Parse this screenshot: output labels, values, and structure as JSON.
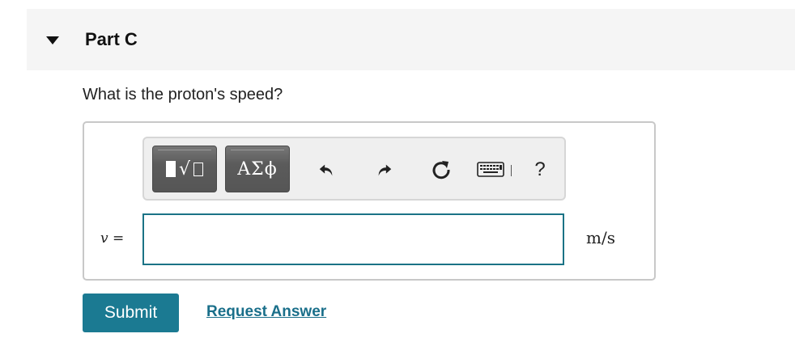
{
  "part": {
    "title": "Part C"
  },
  "question": "What is the proton's speed?",
  "toolbar": {
    "templates_icon": "templates-icon",
    "symbols_label": "ΑΣϕ",
    "undo_icon": "undo-arrow-icon",
    "redo_icon": "redo-arrow-icon",
    "reset_icon": "reset-icon",
    "keyboard_icon": "keyboard-icon",
    "help_label": "?"
  },
  "answer": {
    "variable": "v",
    "equals": "=",
    "value": "",
    "unit": "m/s"
  },
  "actions": {
    "submit_label": "Submit",
    "request_label": "Request Answer"
  },
  "colors": {
    "accent": "#1b7a92",
    "input_border": "#1b7386",
    "header_bg": "#f5f5f5"
  }
}
